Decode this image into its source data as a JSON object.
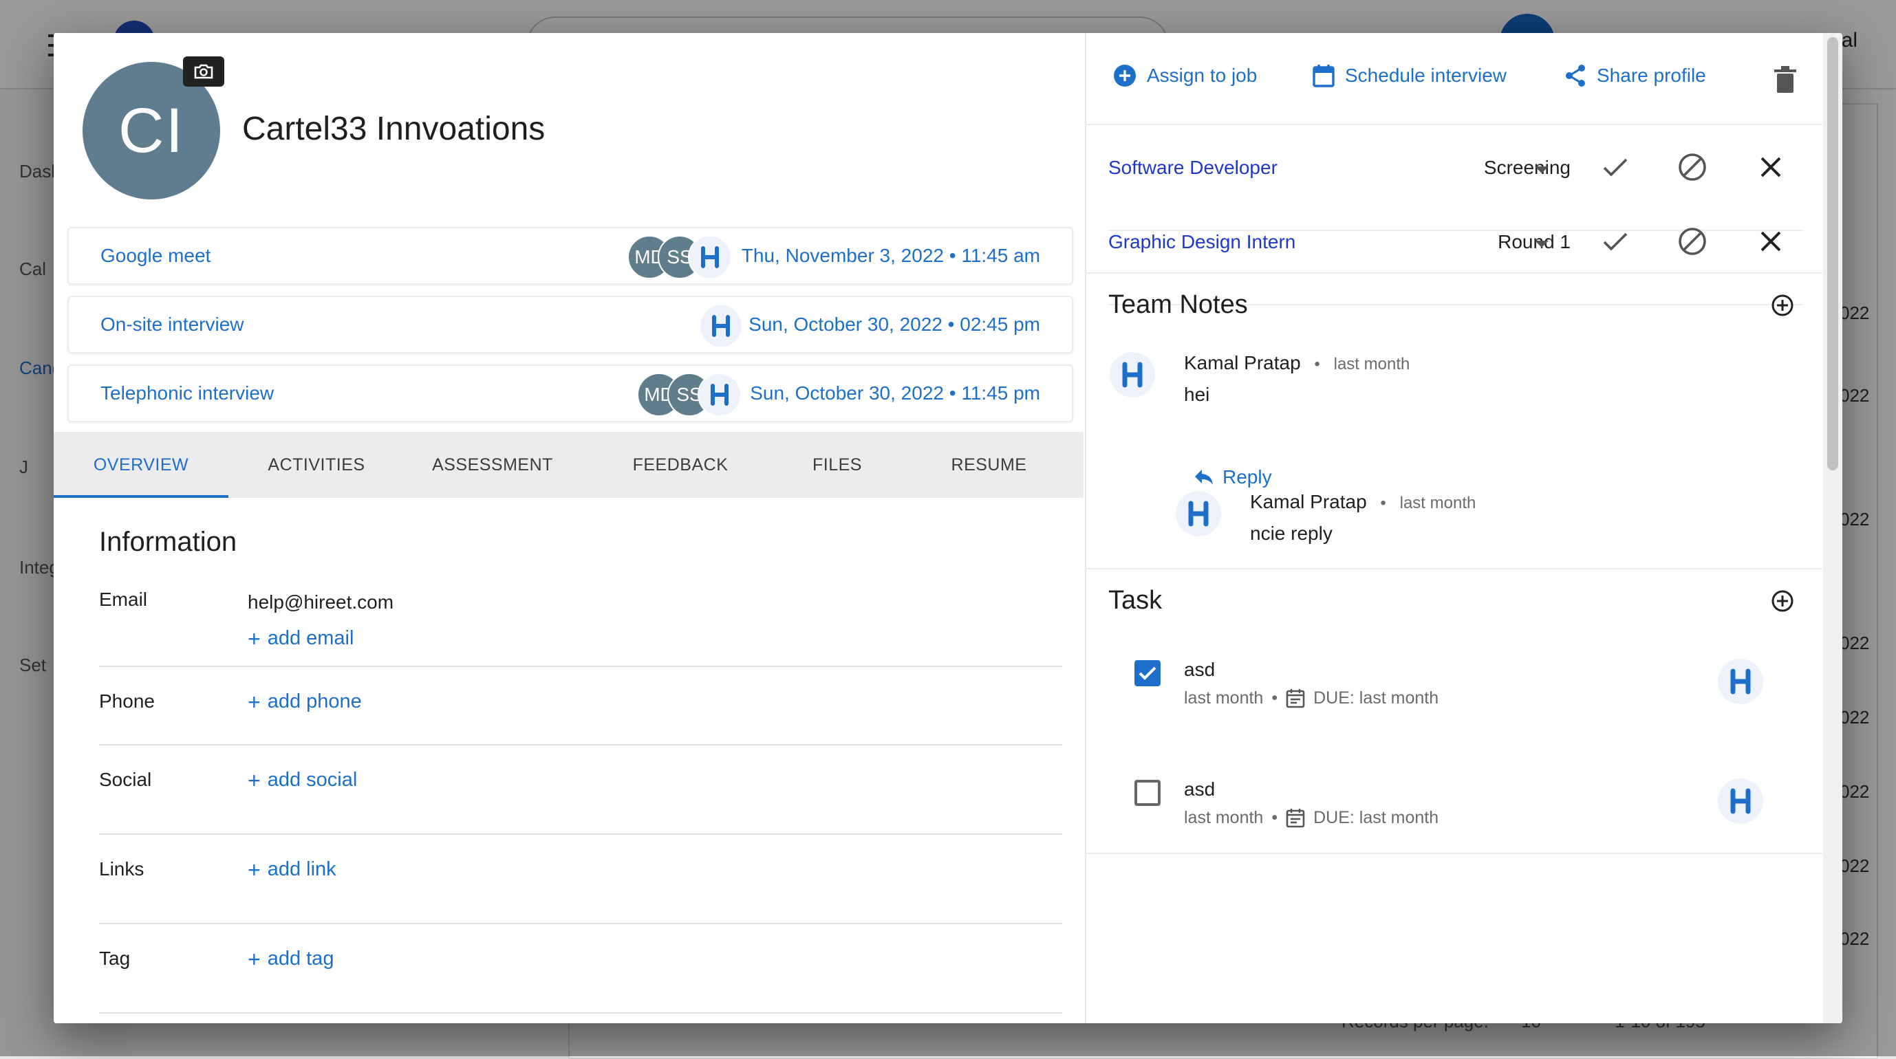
{
  "background": {
    "user_name_partial": "nal",
    "sidebar_labels": [
      "Dash",
      "Cal",
      "Cand",
      "J",
      "Integ",
      "Set"
    ],
    "year_cells": [
      "022",
      "022",
      "022",
      "022",
      "022",
      "022",
      "022",
      "022"
    ],
    "footer": {
      "records_label": "Records per page:",
      "records_value": "10",
      "range": "1-10 of 195"
    }
  },
  "header": {
    "avatar_initials": "CI",
    "company_name": "Cartel33 Innvoations"
  },
  "interviews": [
    {
      "title": "Google meet",
      "datetime": "Thu, November 3, 2022 • 11:45 am",
      "attendees": [
        "MD",
        "SS",
        "H"
      ]
    },
    {
      "title": "On-site interview",
      "datetime": "Sun, October 30, 2022 • 02:45 pm",
      "attendees": [
        "H"
      ]
    },
    {
      "title": "Telephonic interview",
      "datetime": "Sun, October 30, 2022 • 11:45 pm",
      "attendees": [
        "MD",
        "SS",
        "H"
      ]
    }
  ],
  "tabs": [
    "OVERVIEW",
    "ACTIVITIES",
    "ASSESSMENT",
    "FEEDBACK",
    "FILES",
    "RESUME"
  ],
  "information": {
    "title": "Information",
    "email_label": "Email",
    "email_value": "help@hireet.com",
    "add_email": "add email",
    "phone_label": "Phone",
    "add_phone": "add phone",
    "social_label": "Social",
    "add_social": "add social",
    "links_label": "Links",
    "add_link": "add link",
    "tag_label": "Tag",
    "add_tag": "add tag"
  },
  "actions": {
    "assign": "Assign to job",
    "schedule": "Schedule interview",
    "share": "Share profile"
  },
  "jobs": [
    {
      "name": "Software Developer",
      "stage": "Screening"
    },
    {
      "name": "Graphic Design Intern",
      "stage": "Round 1"
    }
  ],
  "team_notes": {
    "title": "Team Notes",
    "note": {
      "author": "Kamal Pratap",
      "time": "last month",
      "text": "hei"
    },
    "reply_label": "Reply",
    "reply": {
      "author": "Kamal Pratap",
      "time": "last month",
      "text": "ncie reply"
    }
  },
  "tasks": {
    "title": "Task",
    "items": [
      {
        "title": "asd",
        "created": "last month",
        "due": "DUE: last month",
        "checked": true
      },
      {
        "title": "asd",
        "created": "last month",
        "due": "DUE: last month",
        "checked": false
      }
    ]
  },
  "colors": {
    "accent": "#1d6fca",
    "avatar": "#5f7d8e",
    "job_link": "#1f38c9"
  }
}
